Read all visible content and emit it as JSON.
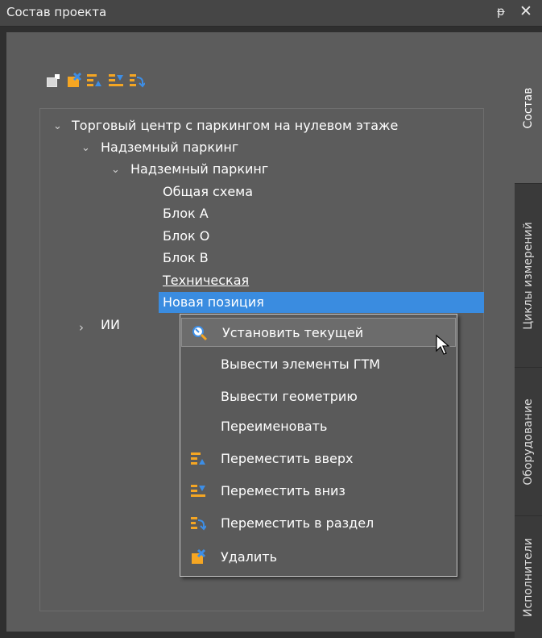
{
  "window": {
    "title": "Состав проекта",
    "pin_glyph": "ᵽ",
    "close_glyph": "✕"
  },
  "toolbar": {
    "icons": [
      "add-node-icon",
      "delete-icon",
      "move-up-icon",
      "move-down-icon",
      "move-to-section-icon"
    ]
  },
  "tree": {
    "root": {
      "label": "Торговый центр с паркингом на нулевом этаже",
      "expanded": true
    },
    "level1": {
      "label": "Надземный паркинг",
      "expanded": true
    },
    "level2": {
      "label": "Надземный паркинг",
      "expanded": true
    },
    "leaves": [
      "Общая схема",
      "Блок А",
      "Блок О",
      "Блок В",
      "Техническая",
      "Новая позиция"
    ],
    "selected": "Новая позиция",
    "sibling": {
      "label": "ИИ",
      "expanded": false
    }
  },
  "context_menu": {
    "items": [
      {
        "label": "Установить текущей",
        "icon": "magnifier-icon"
      },
      {
        "label": "Вывести элементы ГТМ",
        "icon": ""
      },
      {
        "label": "Вывести геометрию",
        "icon": ""
      },
      {
        "label": "Переименовать",
        "icon": ""
      },
      {
        "label": "Переместить вверх",
        "icon": "move-up-icon"
      },
      {
        "label": "Переместить вниз",
        "icon": "move-down-icon"
      },
      {
        "label": "Переместить в раздел",
        "icon": "move-to-section-icon"
      },
      {
        "label": "Удалить",
        "icon": "delete-icon"
      }
    ],
    "hovered": "Установить текущей"
  },
  "side_tabs": {
    "items": [
      "Состав",
      "Циклы измерений",
      "Оборудование",
      "Исполнители"
    ],
    "active": "Состав"
  },
  "colors": {
    "panel_bg": "#5c5c5c",
    "selection": "#3a8ce0",
    "accent_orange": "#f5a623",
    "accent_blue": "#3d8ee6"
  }
}
